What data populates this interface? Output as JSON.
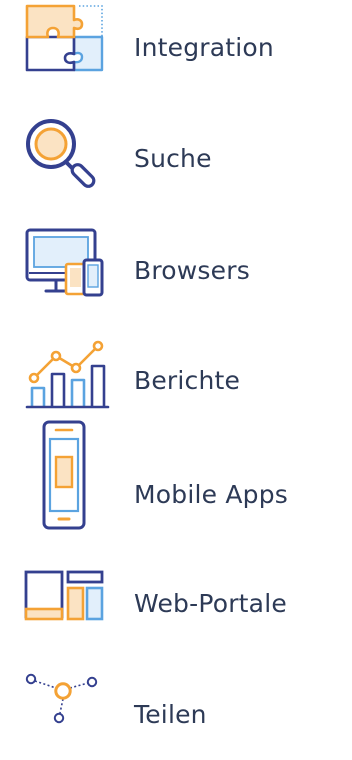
{
  "colors": {
    "navy": "#34408f",
    "orange": "#f4a235",
    "blue": "#5ba3e0",
    "text": "#2d3a56"
  },
  "features": [
    {
      "label": "Integration",
      "icon": "puzzle-icon"
    },
    {
      "label": "Suche",
      "icon": "magnifier-icon"
    },
    {
      "label": "Browsers",
      "icon": "desktop-devices-icon"
    },
    {
      "label": "Berichte",
      "icon": "bar-chart-icon"
    },
    {
      "label": "Mobile Apps",
      "icon": "smartphone-icon"
    },
    {
      "label": "Web-Portale",
      "icon": "portal-layout-icon"
    },
    {
      "label": "Teilen",
      "icon": "share-nodes-icon"
    }
  ]
}
